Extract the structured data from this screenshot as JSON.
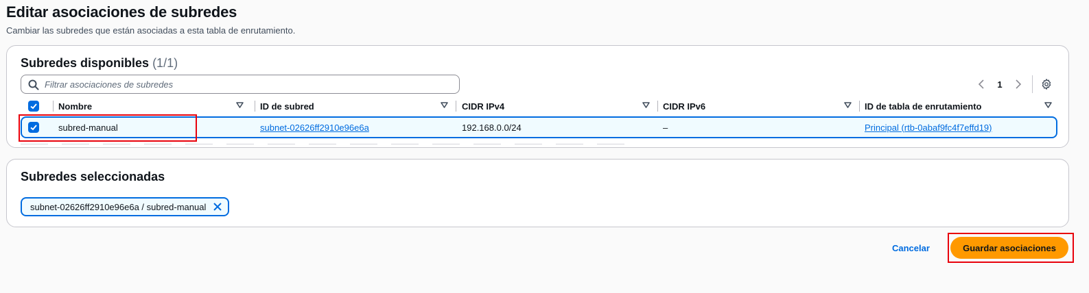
{
  "page": {
    "title": "Editar asociaciones de subredes",
    "description": "Cambiar las subredes que están asociadas a esta tabla de enrutamiento."
  },
  "available": {
    "title": "Subredes disponibles",
    "count": "(1/1)",
    "filter_placeholder": "Filtrar asociaciones de subredes",
    "page_number": "1",
    "columns": [
      "Nombre",
      "ID de subred",
      "CIDR IPv4",
      "CIDR IPv6",
      "ID de tabla de enrutamiento"
    ],
    "rows": [
      {
        "selected": true,
        "name": "subred-manual",
        "subnet_id": "subnet-02626ff2910e96e6a",
        "cidr_ipv4": "192.168.0.0/24",
        "cidr_ipv6": "–",
        "route_table": "Principal (rtb-0abaf9fc4f7effd19)"
      }
    ]
  },
  "selected": {
    "title": "Subredes seleccionadas",
    "token": "subnet-02626ff2910e96e6a / subred-manual"
  },
  "actions": {
    "cancel": "Cancelar",
    "save": "Guardar asociaciones"
  },
  "colors": {
    "accent": "#006ce0",
    "primary_button": "#ff9900",
    "highlight": "#e8000b"
  },
  "icons": [
    "search-icon",
    "chevron-left-icon",
    "chevron-right-icon",
    "settings-icon",
    "sort-icon",
    "check-icon",
    "close-icon"
  ]
}
